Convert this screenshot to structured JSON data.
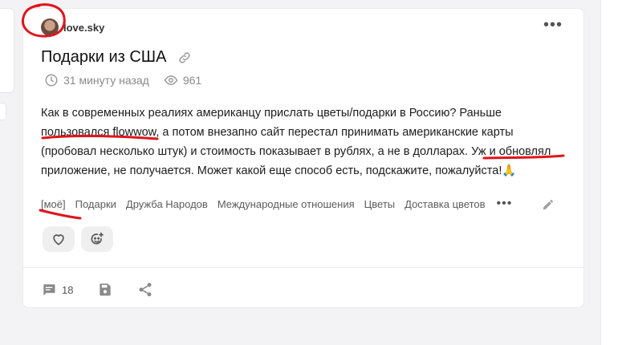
{
  "post": {
    "author": "love.sky",
    "title": "Подарки из США",
    "time_ago": "31 минуту назад",
    "views": "961",
    "body": "Как в современных реалиях американцу прислать цветы/подарки в Россию? Раньше пользовался flowwow, а потом внезапно сайт перестал принимать американские карты (пробовал несколько штук) и стоимость показывает в рублях, а не в долларах. Уж и обновлял приложение, не получается. Может какой еще способ есть, подскажите, пожалуйста!🙏",
    "tags": [
      "[моё]",
      "Подарки",
      "Дружба Народов",
      "Международные отношения",
      "Цветы",
      "Доставка цветов"
    ],
    "tags_more": "•••",
    "more_menu": "•••",
    "comments_count": "18"
  },
  "icons": {
    "link": "link-icon",
    "clock": "clock-icon",
    "eye": "eye-icon",
    "heart": "heart-icon",
    "emoji_add": "emoji-add-icon",
    "comment": "comment-icon",
    "save": "save-icon",
    "share": "share-icon",
    "edit": "pencil-icon"
  },
  "colors": {
    "annotation_red": "#e0141b",
    "muted_text": "#8a8a8a",
    "reaction_bg": "#efefef"
  }
}
